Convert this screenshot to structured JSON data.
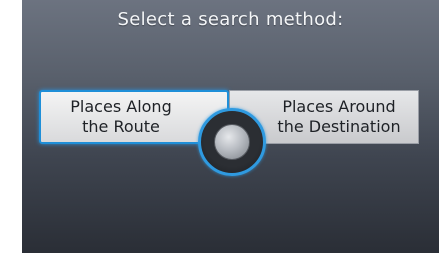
{
  "title": "Select a search method:",
  "options": [
    {
      "line1": "Places Along",
      "line2": "the Route",
      "selected": true
    },
    {
      "line1": "Places Around",
      "line2": "the Destination",
      "selected": false
    }
  ],
  "colors": {
    "highlight": "#1f8fd8",
    "background": "#59606c"
  },
  "icons": {
    "joystick": "joystick-knob-icon"
  }
}
